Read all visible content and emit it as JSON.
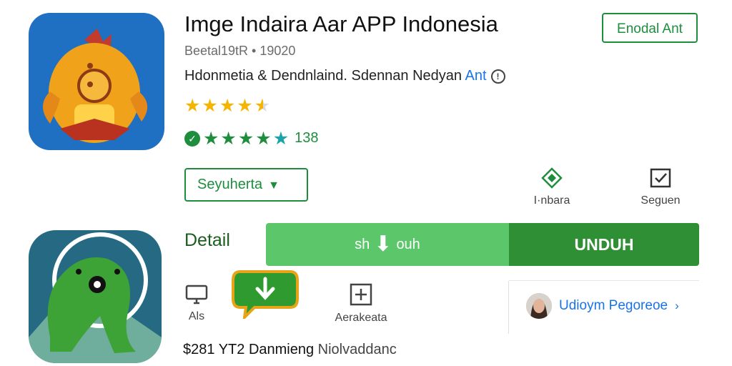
{
  "app": {
    "title": "Imge Indaira Aar APP Indonesia",
    "meta": "Beetal19tR • 19020",
    "developer_prefix": "Hdonmetia & Dendnlaind. Sdennan Nedyan",
    "developer_link": "Ant",
    "info_icon": "info-icon"
  },
  "rating": {
    "stars": 4.5,
    "green_stars": 4.5,
    "count": "138",
    "badge_icon": "check-badge-icon"
  },
  "buttons": {
    "open_label": "Enodal Ant",
    "suggest_label": "Seyuherta",
    "detail_label": "Detail",
    "download_light_left": "sh",
    "download_light_right": "ouh",
    "download_dark": "UNDUH"
  },
  "actions": [
    {
      "label": "I·nbara",
      "icon": "diamond-icon"
    },
    {
      "label": "Seguen",
      "icon": "checkbox-icon"
    },
    {
      "label": "Als",
      "icon": "monitor-icon"
    },
    {
      "label": "Aerakeata",
      "icon": "add-box-icon"
    }
  ],
  "profile": {
    "name": "Udioym Pegoreoe",
    "avatar_icon": "avatar"
  },
  "footer": {
    "price": "$281 YT2",
    "text": "Danmieng",
    "muted": "Niolvaddanc"
  },
  "colors": {
    "accent_green": "#1e8e3e",
    "button_light_green": "#5cc76a",
    "button_dark_green": "#2f8f34",
    "link_blue": "#1a73e8",
    "star_yellow": "#f4b400",
    "icon1_bg": "#1f6fc3",
    "icon2_bg": "#256a82"
  }
}
